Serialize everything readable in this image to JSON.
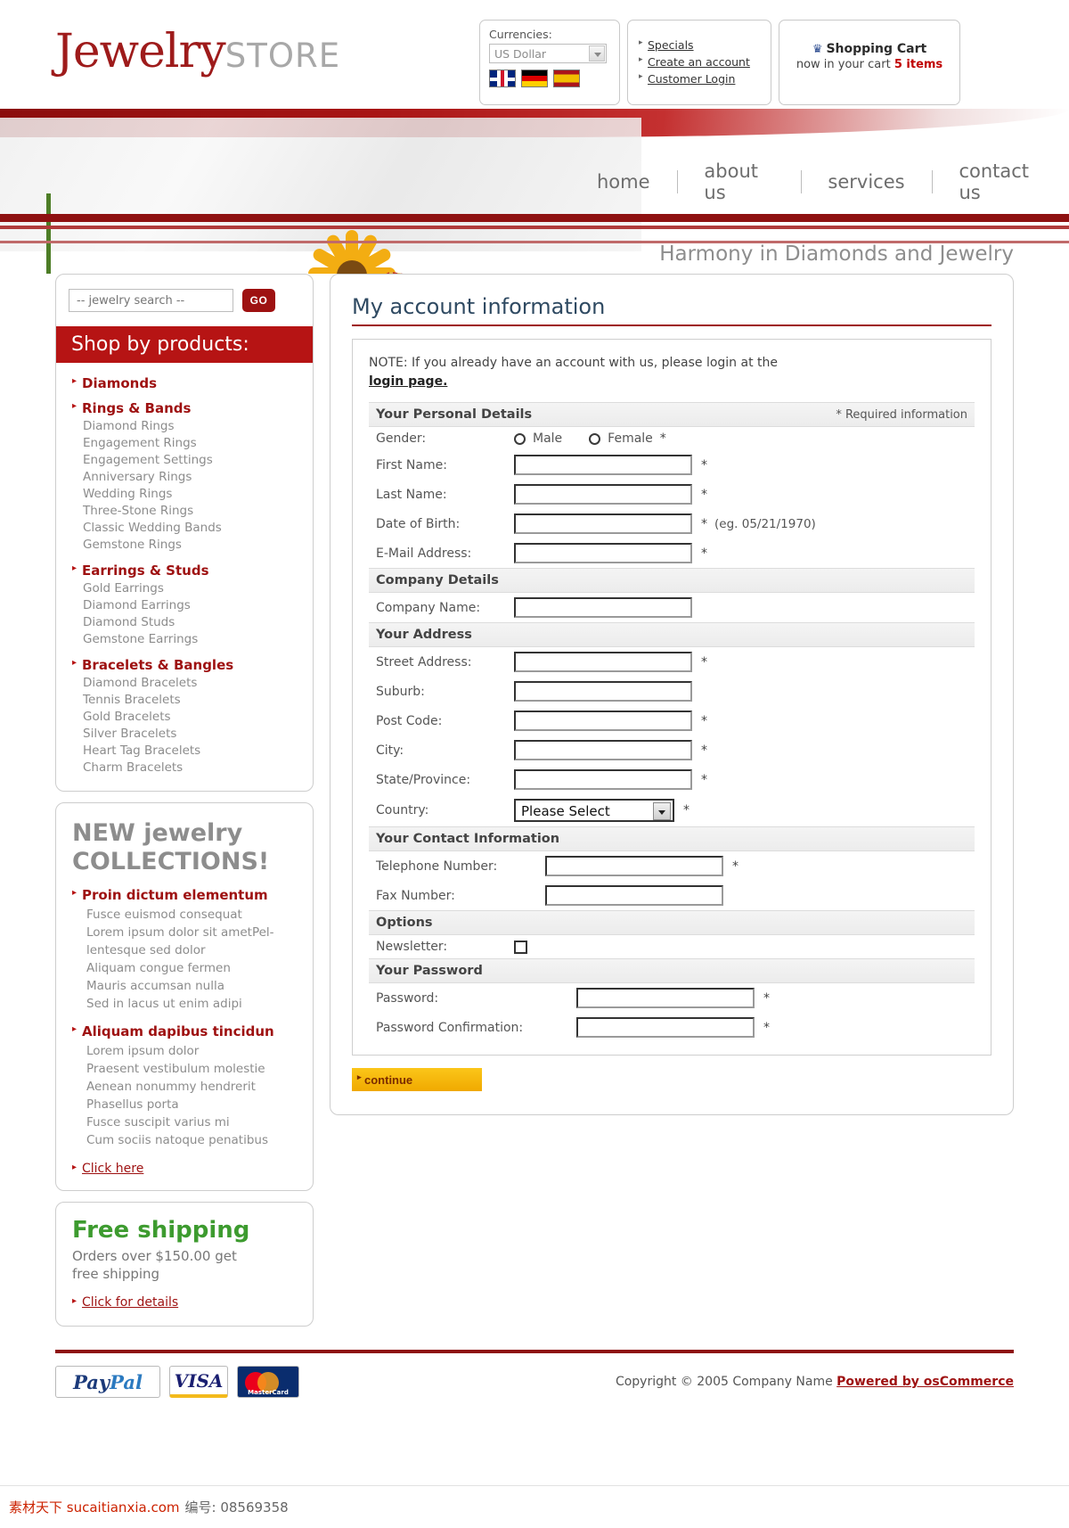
{
  "header": {
    "logo_primary": "Jewelry",
    "logo_secondary": "STORE",
    "currencies_label": "Currencies:",
    "currency_selected": "US Dollar",
    "flags": [
      "uk-flag",
      "germany-flag",
      "spain-flag"
    ],
    "links": [
      "Specials",
      "Create an account",
      "Customer Login"
    ],
    "cart_title": "Shopping Cart",
    "cart_prefix": "now in your cart ",
    "cart_count": "5 items"
  },
  "nav": {
    "items": [
      "home",
      "about us",
      "services",
      "contact us"
    ],
    "tagline": "Harmony in Diamonds and Jewelry"
  },
  "sidebar": {
    "search_placeholder": "-- jewelry search --",
    "search_button": "GO",
    "shop_by_title": "Shop by products:",
    "categories": [
      {
        "title": "Diamonds",
        "items": []
      },
      {
        "title": "Rings & Bands",
        "items": [
          "Diamond Rings",
          "Engagement Rings",
          "Engagement Settings",
          "Anniversary Rings",
          "Wedding Rings",
          "Three-Stone Rings",
          "Classic Wedding Bands",
          "Gemstone Rings"
        ]
      },
      {
        "title": "Earrings & Studs",
        "items": [
          "Gold Earrings",
          "Diamond Earrings",
          "Diamond Studs",
          "Gemstone Earrings"
        ]
      },
      {
        "title": "Bracelets & Bangles",
        "items": [
          "Diamond Bracelets",
          "Tennis Bracelets",
          "Gold Bracelets",
          "Silver Bracelets",
          "Heart Tag Bracelets",
          "Charm Bracelets"
        ]
      }
    ],
    "collections_title_line1": "NEW jewelry",
    "collections_title_line2": "COLLECTIONS!",
    "collections": [
      {
        "title": "Proin dictum elementum",
        "items": [
          "Fusce euismod consequat",
          "Lorem ipsum dolor sit ametPel-",
          "lentesque sed dolor",
          "Aliquam congue fermen",
          "Mauris accumsan nulla",
          "Sed in lacus ut enim adipi"
        ]
      },
      {
        "title": "Aliquam dapibus tincidun",
        "items": [
          "Lorem ipsum dolor",
          "Praesent vestibulum molestie",
          "Aenean nonummy hendrerit",
          "Phasellus porta",
          "Fusce suscipit varius mi",
          "Cum sociis natoque penatibus"
        ]
      }
    ],
    "collections_link": "Click here",
    "shipping_title": "Free shipping",
    "shipping_text_line1": "Orders over $150.00 get",
    "shipping_text_line2": "free shipping",
    "shipping_link": "Click for details"
  },
  "main": {
    "page_title": "My account information",
    "note_text": "NOTE: If you already have an account with us, please login at the ",
    "note_link": "login page.",
    "sections": {
      "personal": "Your Personal Details",
      "required": "* Required information",
      "company": "Company Details",
      "address": "Your Address",
      "contact": "Your Contact Information",
      "options": "Options",
      "password": "Your Password"
    },
    "fields": {
      "gender": "Gender:",
      "gender_male": "Male",
      "gender_female": "Female",
      "first_name": "First Name:",
      "last_name": "Last Name:",
      "dob": "Date of Birth:",
      "dob_hint": "(eg. 05/21/1970)",
      "email": "E-Mail Address:",
      "company_name": "Company Name:",
      "street": "Street Address:",
      "suburb": "Suburb:",
      "post_code": "Post Code:",
      "city": "City:",
      "state": "State/Province:",
      "country": "Country:",
      "country_value": "Please Select",
      "telephone": "Telephone Number:",
      "fax": "Fax Number:",
      "newsletter": "Newsletter:",
      "password": "Password:",
      "password_confirm": "Password Confirmation:"
    },
    "required_marker": "*",
    "continue_label": "continue"
  },
  "footer": {
    "paypal_1": "Pay",
    "paypal_2": "Pal",
    "visa": "VISA",
    "mastercard": "MasterCard",
    "copyright": "Copyright © 2005 Company Name ",
    "powered_by": "Powered by osCommerce"
  },
  "watermark": {
    "site": "素材天下 sucaitianxia.com",
    "code_label": "编号: 08569358"
  },
  "colors": {
    "brand_red": "#9e1111",
    "accent_red": "#b61414",
    "green": "#3d9b2f",
    "amber": "#f0a900"
  }
}
